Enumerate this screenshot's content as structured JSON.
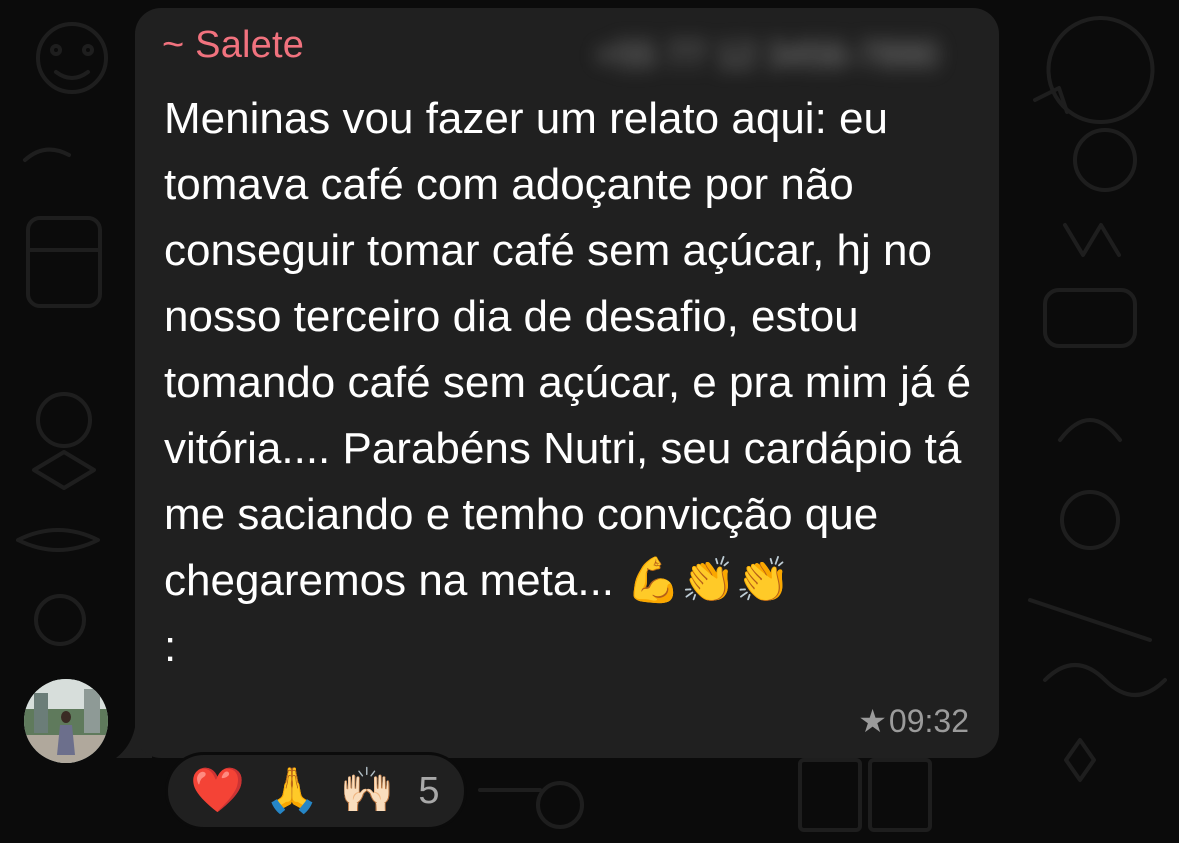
{
  "message": {
    "sender": "~ Salete",
    "phone_redacted": "+55 77 12 3456-7890",
    "text": "Meninas vou fazer um relato aqui: eu tomava café com adoçante por não conseguir tomar café sem açúcar, hj no nosso terceiro dia de desafio, estou tomando café sem açúcar, e pra mim já é vitória.... Parabéns Nutri, seu cardápio tá me saciando e temho convicção que chegaremos na meta... 💪👏👏\n:",
    "starred": "★",
    "time": "09:32"
  },
  "reactions": {
    "items": [
      "❤️",
      "🙏",
      "🙌🏻"
    ],
    "count": "5"
  },
  "colors": {
    "sender_name": "#f1727e",
    "bubble": "#202020",
    "background": "#0b0b0b"
  },
  "icons": {
    "avatar": "avatar-photo",
    "star": "star-icon"
  }
}
